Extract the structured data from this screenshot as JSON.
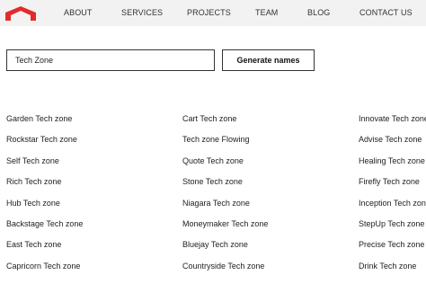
{
  "nav": {
    "logo_icon": "red-chevron-logo-icon",
    "items": [
      "ABOUT",
      "SERVICES",
      "PROJECTS",
      "TEAM",
      "BLOG",
      "CONTACT US"
    ]
  },
  "generator": {
    "input_value": "Tech Zone",
    "button_label": "Generate names"
  },
  "results": {
    "columns": [
      [
        "Garden Tech zone",
        "Rockstar Tech zone",
        "Self Tech zone",
        "Rich Tech zone",
        "Hub Tech zone",
        "Backstage Tech zone",
        "East Tech zone",
        "Capricorn Tech zone"
      ],
      [
        "Cart Tech zone",
        "Tech zone Flowing",
        "Quote Tech zone",
        "Stone Tech zone",
        "Niagara Tech zone",
        "Moneymaker Tech zone",
        "Bluejay Tech zone",
        "Countryside Tech zone"
      ],
      [
        "Innovate Tech zone",
        "Advise Tech zone",
        "Healing Tech zone",
        "Firefly Tech zone",
        "Inception Tech zone",
        "StepUp Tech zone",
        "Precise Tech zone",
        "Drink Tech zone"
      ]
    ]
  },
  "colors": {
    "brand": "#e32b2b",
    "topbar": "#f2f2f2"
  }
}
